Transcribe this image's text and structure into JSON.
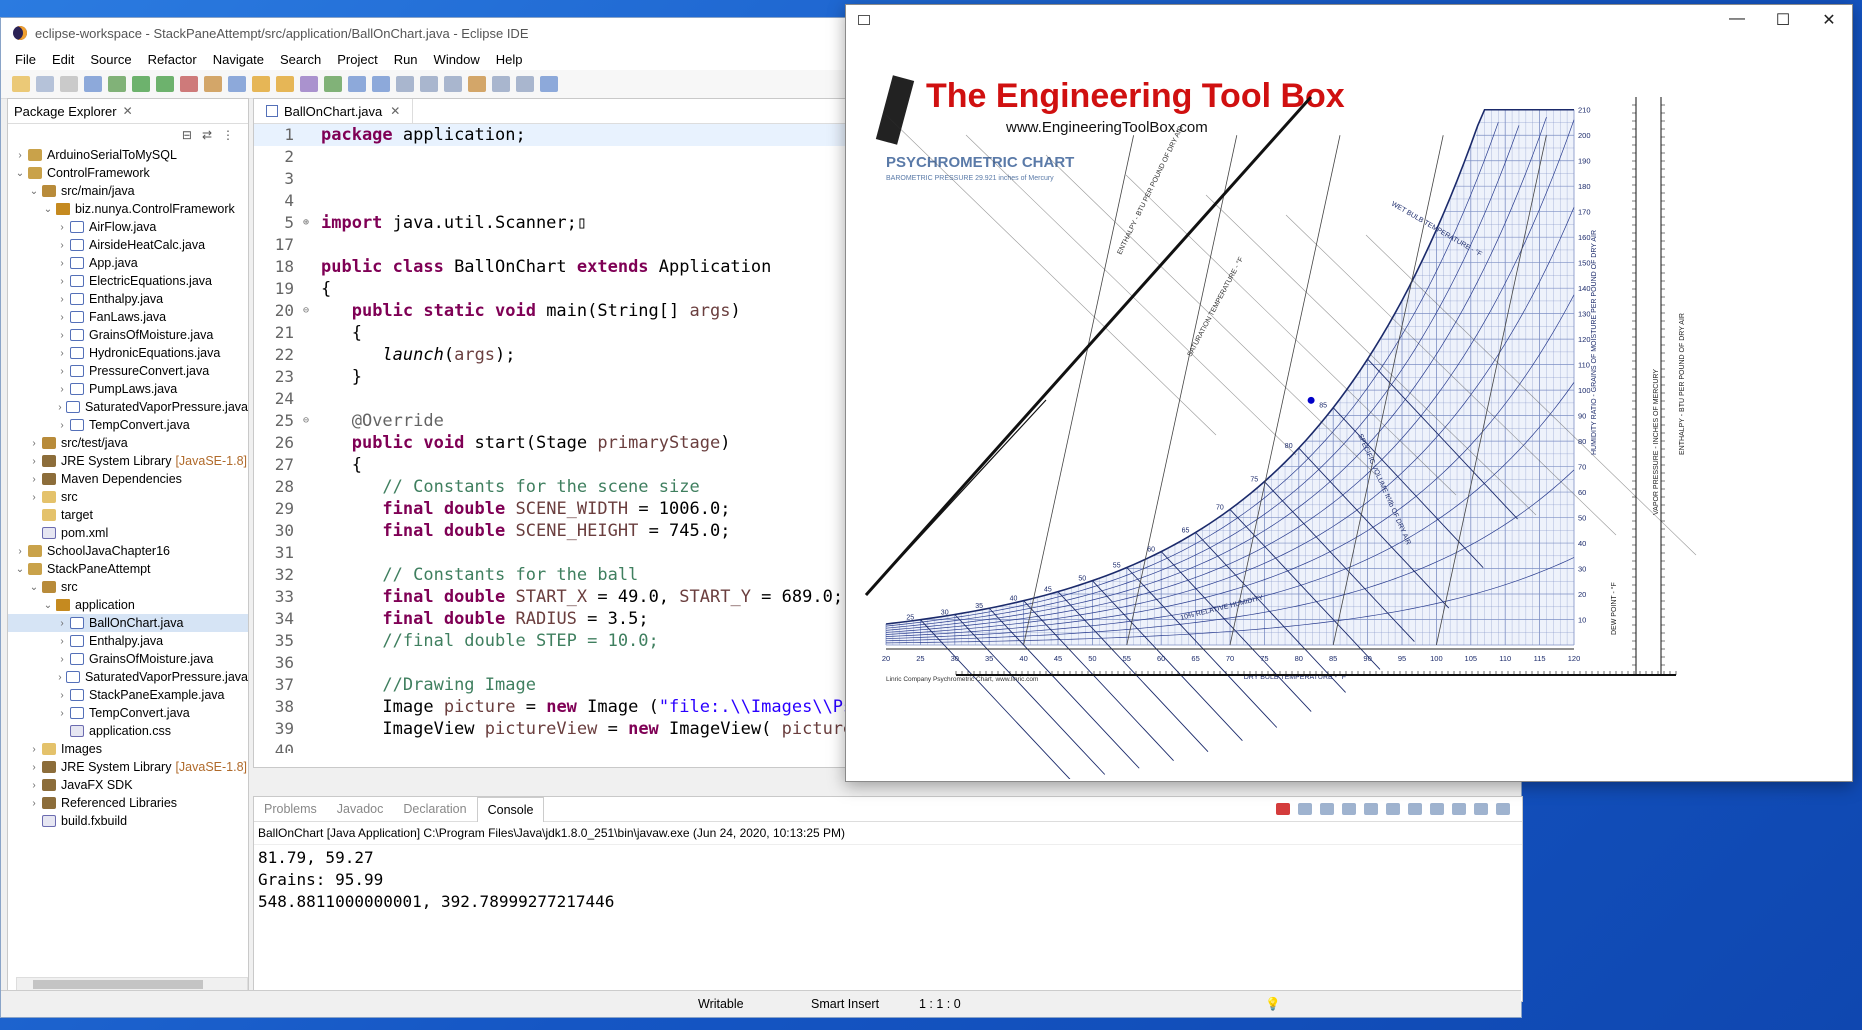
{
  "window": {
    "title": "eclipse-workspace - StackPaneAttempt/src/application/BallOnChart.java - Eclipse IDE"
  },
  "menu": [
    "File",
    "Edit",
    "Source",
    "Refactor",
    "Navigate",
    "Search",
    "Project",
    "Run",
    "Window",
    "Help"
  ],
  "package_explorer": {
    "title": "Package Explorer",
    "rows": [
      {
        "arrow": "›",
        "indent": 0,
        "icon": "proj",
        "label": "ArduinoSerialToMySQL"
      },
      {
        "arrow": "⌄",
        "indent": 0,
        "icon": "proj",
        "label": "ControlFramework"
      },
      {
        "arrow": "⌄",
        "indent": 1,
        "icon": "src",
        "label": "src/main/java"
      },
      {
        "arrow": "⌄",
        "indent": 2,
        "icon": "pkgi",
        "label": "biz.nunya.ControlFramework"
      },
      {
        "arrow": "›",
        "indent": 3,
        "icon": "java",
        "label": "AirFlow.java"
      },
      {
        "arrow": "›",
        "indent": 3,
        "icon": "java",
        "label": "AirsideHeatCalc.java"
      },
      {
        "arrow": "›",
        "indent": 3,
        "icon": "java",
        "label": "App.java"
      },
      {
        "arrow": "›",
        "indent": 3,
        "icon": "java",
        "label": "ElectricEquations.java"
      },
      {
        "arrow": "›",
        "indent": 3,
        "icon": "java",
        "label": "Enthalpy.java"
      },
      {
        "arrow": "›",
        "indent": 3,
        "icon": "java",
        "label": "FanLaws.java"
      },
      {
        "arrow": "›",
        "indent": 3,
        "icon": "java",
        "label": "GrainsOfMoisture.java"
      },
      {
        "arrow": "›",
        "indent": 3,
        "icon": "java",
        "label": "HydronicEquations.java"
      },
      {
        "arrow": "›",
        "indent": 3,
        "icon": "java",
        "label": "PressureConvert.java"
      },
      {
        "arrow": "›",
        "indent": 3,
        "icon": "java",
        "label": "PumpLaws.java"
      },
      {
        "arrow": "›",
        "indent": 3,
        "icon": "java",
        "label": "SaturatedVaporPressure.java"
      },
      {
        "arrow": "›",
        "indent": 3,
        "icon": "java",
        "label": "TempConvert.java"
      },
      {
        "arrow": "›",
        "indent": 1,
        "icon": "src",
        "label": "src/test/java"
      },
      {
        "arrow": "›",
        "indent": 1,
        "icon": "lib",
        "label": "JRE System Library",
        "extra": "[JavaSE-1.8]"
      },
      {
        "arrow": "›",
        "indent": 1,
        "icon": "lib",
        "label": "Maven Dependencies"
      },
      {
        "arrow": "›",
        "indent": 1,
        "icon": "fold",
        "label": "src"
      },
      {
        "arrow": "",
        "indent": 1,
        "icon": "fold",
        "label": "target"
      },
      {
        "arrow": "",
        "indent": 1,
        "icon": "xml",
        "label": "pom.xml"
      },
      {
        "arrow": "›",
        "indent": 0,
        "icon": "proj",
        "label": "SchoolJavaChapter16"
      },
      {
        "arrow": "⌄",
        "indent": 0,
        "icon": "proj",
        "label": "StackPaneAttempt"
      },
      {
        "arrow": "⌄",
        "indent": 1,
        "icon": "src",
        "label": "src"
      },
      {
        "arrow": "⌄",
        "indent": 2,
        "icon": "pkgi",
        "label": "application"
      },
      {
        "arrow": "›",
        "indent": 3,
        "icon": "java",
        "label": "BallOnChart.java",
        "selected": true
      },
      {
        "arrow": "›",
        "indent": 3,
        "icon": "java",
        "label": "Enthalpy.java"
      },
      {
        "arrow": "›",
        "indent": 3,
        "icon": "java",
        "label": "GrainsOfMoisture.java"
      },
      {
        "arrow": "›",
        "indent": 3,
        "icon": "java",
        "label": "SaturatedVaporPressure.java"
      },
      {
        "arrow": "›",
        "indent": 3,
        "icon": "java",
        "label": "StackPaneExample.java"
      },
      {
        "arrow": "›",
        "indent": 3,
        "icon": "java",
        "label": "TempConvert.java"
      },
      {
        "arrow": "",
        "indent": 3,
        "icon": "xml",
        "label": "application.css"
      },
      {
        "arrow": "›",
        "indent": 1,
        "icon": "fold",
        "label": "Images"
      },
      {
        "arrow": "›",
        "indent": 1,
        "icon": "lib",
        "label": "JRE System Library",
        "extra": "[JavaSE-1.8]"
      },
      {
        "arrow": "›",
        "indent": 1,
        "icon": "lib",
        "label": "JavaFX SDK"
      },
      {
        "arrow": "›",
        "indent": 1,
        "icon": "lib",
        "label": "Referenced Libraries"
      },
      {
        "arrow": "",
        "indent": 1,
        "icon": "xml",
        "label": "build.fxbuild"
      }
    ]
  },
  "editor": {
    "tab": "BallOnChart.java",
    "lines": [
      {
        "n": "1",
        "html": "<span class=\"kw\">package</span> application;",
        "hl": true
      },
      {
        "n": "2",
        "html": ""
      },
      {
        "n": "3",
        "html": ""
      },
      {
        "n": "4",
        "html": ""
      },
      {
        "n": "5",
        "g": "⊕",
        "html": "<span class=\"kw\">import</span> java.util.Scanner;▯"
      },
      {
        "n": "17",
        "html": ""
      },
      {
        "n": "18",
        "html": "<span class=\"kw\">public class</span> BallOnChart <span class=\"kw\">extends</span> Application"
      },
      {
        "n": "19",
        "html": "{"
      },
      {
        "n": "20",
        "g": "⊖",
        "html": "   <span class=\"kw\">public static void</span> main(String[] <span class=\"pa\">args</span>)"
      },
      {
        "n": "21",
        "html": "   {"
      },
      {
        "n": "22",
        "html": "      <span class=\"it\">launch</span>(<span class=\"pa\">args</span>);"
      },
      {
        "n": "23",
        "html": "   }"
      },
      {
        "n": "24",
        "html": ""
      },
      {
        "n": "25",
        "g": "⊖",
        "html": "   <span class=\"an\">@Override</span>"
      },
      {
        "n": "26",
        "html": "   <span class=\"kw\">public void</span> start(Stage <span class=\"pa\">primaryStage</span>)"
      },
      {
        "n": "27",
        "html": "   {"
      },
      {
        "n": "28",
        "html": "      <span class=\"cm\">// Constants for the scene size</span>"
      },
      {
        "n": "29",
        "html": "      <span class=\"kw\">final double</span> <span class=\"pa\">SCENE_WIDTH</span> = 1006.0;"
      },
      {
        "n": "30",
        "html": "      <span class=\"kw\">final double</span> <span class=\"pa\">SCENE_HEIGHT</span> = 745.0;"
      },
      {
        "n": "31",
        "html": ""
      },
      {
        "n": "32",
        "html": "      <span class=\"cm\">// Constants for the ball</span>"
      },
      {
        "n": "33",
        "html": "      <span class=\"kw\">final double</span> <span class=\"pa\">START_X</span> = 49.0, <span class=\"pa\">START_Y</span> = 689.0;"
      },
      {
        "n": "34",
        "html": "      <span class=\"kw\">final double</span> <span class=\"pa\">RADIUS</span> = 3.5;"
      },
      {
        "n": "35",
        "html": "      <span class=\"cm\">//final double STEP = 10.0;</span>"
      },
      {
        "n": "36",
        "html": ""
      },
      {
        "n": "37",
        "html": "      <span class=\"cm\">//Drawing Image</span>"
      },
      {
        "n": "38",
        "html": "      Image <span class=\"pa\">picture</span> = <span class=\"kw\">new</span> Image (<span class=\"st\">\"file:.\\\\Images\\\\Psyc</span>"
      },
      {
        "n": "39",
        "html": "      ImageView <span class=\"pa\">pictureView</span> = <span class=\"kw\">new</span> ImageView( <span class=\"pa\">picture</span> )"
      },
      {
        "n": "40",
        "html": ""
      }
    ]
  },
  "console": {
    "tabs": [
      "Problems",
      "Javadoc",
      "Declaration",
      "Console"
    ],
    "active": "Console",
    "desc": "BallOnChart [Java Application] C:\\Program Files\\Java\\jdk1.8.0_251\\bin\\javaw.exe  (Jun 24, 2020, 10:13:25 PM)",
    "output": [
      "81.79, 59.27",
      "Grains: 95.99",
      "548.8811000000001, 392.78999277217446"
    ]
  },
  "status": {
    "writable": "Writable",
    "insert": "Smart Insert",
    "position": "1 : 1 : 0"
  },
  "chart": {
    "brand": "The Engineering Tool Box",
    "url": "www.EngineeringToolBox.com",
    "title": "PSYCHROMETRIC CHART",
    "subtitle": "BAROMETRIC PRESSURE 29.921 inches of Mercury",
    "credit": "Linric Company Psychrometric Chart, www.linric.com",
    "x_axis": "DRY BULB TEMPERATURE - °F",
    "x_ticks": [
      "20",
      "25",
      "30",
      "35",
      "40",
      "45",
      "50",
      "55",
      "60",
      "65",
      "70",
      "75",
      "80",
      "85",
      "90",
      "95",
      "100",
      "105",
      "110",
      "115",
      "120"
    ],
    "right_ticks": [
      "210",
      "200",
      "190",
      "180",
      "170",
      "160",
      "150",
      "140",
      "130",
      "120",
      "110",
      "100",
      "90",
      "80",
      "70",
      "60",
      "50",
      "40",
      "30",
      "20",
      "10"
    ],
    "right_axis": "HUMIDITY RATIO - GRAINS OF MOISTURE PER POUND OF DRY AIR",
    "enthalpy_axis": "ENTHALPY - BTU PER POUND OF DRY AIR",
    "saturation_label": "SATURATION TEMPERATURE - °F",
    "wet_bulb_label": "WET BULB TEMPERATURE - °F",
    "specific_volume_label": "SPECIFIC VOLUME ft³/lb OF DRY AIR",
    "rh_label": "10% RELATIVE HUMIDITY",
    "vapor_axis": "VAPOR PRESSURE - INCHES OF MERCURY",
    "dew_point_axis": "DEW POINT - °F",
    "enthalpy_right_axis": "ENTHALPY - BTU PER POUND OF DRY AIR",
    "sat_ticks": [
      "25",
      "30",
      "35",
      "40",
      "45",
      "50",
      "55",
      "60",
      "65",
      "70",
      "75",
      "80",
      "85"
    ],
    "ball_dot": {
      "dry_bulb": 81.79,
      "grains": 95.99
    }
  }
}
